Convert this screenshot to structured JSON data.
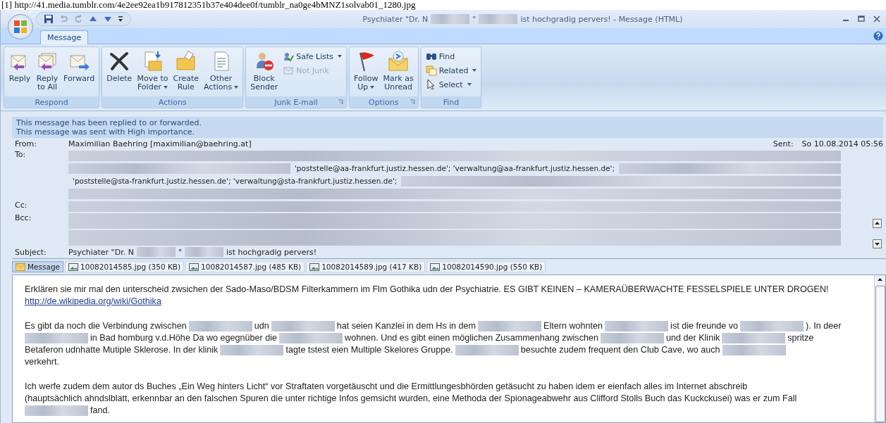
{
  "source_url": "[1] http://41.media.tumblr.com/4e2ee92ea1b917812351b37e404dee0f/tumblr_na0ge4bMNZ1solvab01_1280.jpg",
  "window": {
    "title": [
      {
        "kind": "text",
        "text": "Psychiater \"Dr. N"
      },
      {
        "kind": "redaction"
      },
      {
        "kind": "text",
        "text": "\""
      },
      {
        "kind": "redaction"
      },
      {
        "kind": "text",
        "text": "ist hochgradig pervers! - Message (HTML)"
      }
    ]
  },
  "tabs": [
    {
      "label": "Message",
      "selected": true
    }
  ],
  "ribbon": [
    {
      "label": "Respond",
      "buttons": [
        {
          "kind": "large",
          "lines": [
            "Reply"
          ],
          "dropdown": false,
          "disabled": false
        },
        {
          "kind": "large",
          "lines": [
            "Reply",
            "to All"
          ],
          "dropdown": false,
          "disabled": false
        },
        {
          "kind": "large",
          "lines": [
            "Forward"
          ],
          "dropdown": false,
          "disabled": false
        }
      ],
      "launcher": false
    },
    {
      "label": "Actions",
      "buttons": [
        {
          "kind": "large",
          "lines": [
            "Delete"
          ],
          "dropdown": false,
          "disabled": false
        },
        {
          "kind": "large",
          "lines": [
            "Move to",
            "Folder"
          ],
          "dropdown": true,
          "disabled": false
        },
        {
          "kind": "large",
          "lines": [
            "Create",
            "Rule"
          ],
          "dropdown": false,
          "disabled": false
        },
        {
          "kind": "large",
          "lines": [
            "Other",
            "Actions"
          ],
          "dropdown": true,
          "disabled": false
        }
      ],
      "launcher": false
    },
    {
      "label": "Junk E-mail",
      "buttons": [
        {
          "kind": "large",
          "lines": [
            "Block",
            "Sender"
          ],
          "dropdown": false,
          "disabled": false
        },
        {
          "kind": "small",
          "lines": [
            "Safe Lists"
          ],
          "dropdown": true,
          "disabled": false
        },
        {
          "kind": "small",
          "lines": [
            "Not Junk"
          ],
          "dropdown": false,
          "disabled": true
        }
      ],
      "launcher": true
    },
    {
      "label": "Options",
      "buttons": [
        {
          "kind": "large",
          "lines": [
            "Follow",
            "Up"
          ],
          "dropdown": true,
          "disabled": false
        },
        {
          "kind": "large",
          "lines": [
            "Mark as",
            "Unread"
          ],
          "dropdown": false,
          "disabled": false
        }
      ],
      "launcher": true
    },
    {
      "label": "Find",
      "buttons": [
        {
          "kind": "small",
          "lines": [
            "Find"
          ],
          "dropdown": false,
          "disabled": false
        },
        {
          "kind": "small",
          "lines": [
            "Related"
          ],
          "dropdown": true,
          "disabled": false
        },
        {
          "kind": "small",
          "lines": [
            "Select"
          ],
          "dropdown": true,
          "disabled": false
        }
      ],
      "launcher": false
    }
  ],
  "info_bar": [
    "This message has been replied to or forwarded.",
    "This message was sent with High importance."
  ],
  "header": {
    "from_label": "From:",
    "from": "Maximilian Baehring [maximilian@baehring.at]",
    "sent_label": "Sent:",
    "sent": "So 10.08.2014 05:56",
    "to_label": "To:",
    "to": [
      [
        {
          "kind": "redaction"
        }
      ],
      [
        {
          "kind": "redaction"
        },
        {
          "kind": "text",
          "text": "'poststelle@aa-frankfurt.justiz.hessen.de'; 'verwaltung@aa-frankfurt.justiz.hessen.de';"
        },
        {
          "kind": "redaction"
        }
      ],
      [
        {
          "kind": "text",
          "text": "'poststelle@sta-frankfurt.justiz.hessen.de'; 'verwaltung@sta-frankfurt.justiz.hessen.de';"
        },
        {
          "kind": "redaction"
        }
      ],
      [
        {
          "kind": "redaction"
        }
      ]
    ],
    "cc_label": "Cc:",
    "cc": [
      [
        {
          "kind": "redaction"
        }
      ]
    ],
    "bcc_label": "Bcc:",
    "bcc": [
      [
        {
          "kind": "redaction"
        }
      ],
      [
        {
          "kind": "redaction"
        }
      ]
    ],
    "subject_label": "Subject:",
    "subject": [
      {
        "kind": "text",
        "text": "Psychiater \"Dr. N"
      },
      {
        "kind": "redaction"
      },
      {
        "kind": "text",
        "text": "\""
      },
      {
        "kind": "redaction"
      },
      {
        "kind": "text",
        "text": "ist hochgradig pervers!"
      }
    ]
  },
  "attachments": [
    {
      "kind": "message",
      "label": "Message",
      "selected": true
    },
    {
      "kind": "file",
      "label": "10082014585.jpg (350 KB)",
      "selected": false
    },
    {
      "kind": "file",
      "label": "10082014587.jpg (485 KB)",
      "selected": false
    },
    {
      "kind": "file",
      "label": "10082014589.jpg (417 KB)",
      "selected": false
    },
    {
      "kind": "file",
      "label": "10082014590.jpg (550 KB)",
      "selected": false
    }
  ],
  "body": [
    [
      [
        {
          "kind": "text",
          "text": "Erklären sie mir mal den unterscheid zwsichen der Sado-Maso/BDSM Filterkammern im Flm Gothika udn der Psychiatrie. ES GIBT KEINEN – KAMERAÜBERWACHTE FESSELSPIELE UNTER DROGEN!"
        }
      ],
      [
        {
          "kind": "link",
          "text": "http://de.wikipedia.org/wiki/Gothika"
        }
      ]
    ],
    [
      [
        {
          "kind": "text",
          "text": "Es gibt da noch die Verbindung zwischen"
        },
        {
          "kind": "redaction"
        },
        {
          "kind": "text",
          "text": "udn"
        },
        {
          "kind": "redaction"
        },
        {
          "kind": "text",
          "text": "hat seien Kanzlei in dem Hs in dem"
        },
        {
          "kind": "redaction"
        },
        {
          "kind": "text",
          "text": "Eltern wohnten"
        },
        {
          "kind": "redaction"
        },
        {
          "kind": "text",
          "text": "ist die freunde vo"
        },
        {
          "kind": "redaction"
        },
        {
          "kind": "text",
          "text": "). In deer"
        }
      ],
      [
        {
          "kind": "redaction"
        },
        {
          "kind": "text",
          "text": "in Bad homburg v.d.Höhe Da wo egegnüber die"
        },
        {
          "kind": "redaction"
        },
        {
          "kind": "text",
          "text": "wohnen. Und es gibt einen möglichen Zusammenhang zwischen"
        },
        {
          "kind": "redaction"
        },
        {
          "kind": "text",
          "text": "und der Klinik"
        },
        {
          "kind": "redaction"
        },
        {
          "kind": "text",
          "text": "spritze"
        }
      ],
      [
        {
          "kind": "text",
          "text": "Betaferon udnhatte Mutiple Sklerose. In der klinik"
        },
        {
          "kind": "redaction"
        },
        {
          "kind": "text",
          "text": "tagte tstest eien Multiple Skelores Gruppe."
        },
        {
          "kind": "redaction"
        },
        {
          "kind": "text",
          "text": "besuchte zudem frequent den Club Cave, wo auch"
        },
        {
          "kind": "redaction"
        }
      ],
      [
        {
          "kind": "text",
          "text": "verkehrt."
        }
      ]
    ],
    [
      [
        {
          "kind": "text",
          "text": "Ich werfe zudem dem autor ds Buches „Ein Weg hinters Licht“ vor Straftaten vorgetäuscht und die Ermittlungesbhörden getäsucht zu haben idem er eienfach alles im Internet abschreib"
        }
      ],
      [
        {
          "kind": "text",
          "text": "(hauptsächlich ahndslblatt, erkennbar an den falschen Spuren die unter richtige Infos gemsicht wurden, eine Methoda der Spionageabwehr aus Clifford Stolls Buch das Kuckckusei) was er zum Fall"
        }
      ],
      [
        {
          "kind": "redaction"
        },
        {
          "kind": "text",
          "text": "fand."
        }
      ]
    ]
  ]
}
